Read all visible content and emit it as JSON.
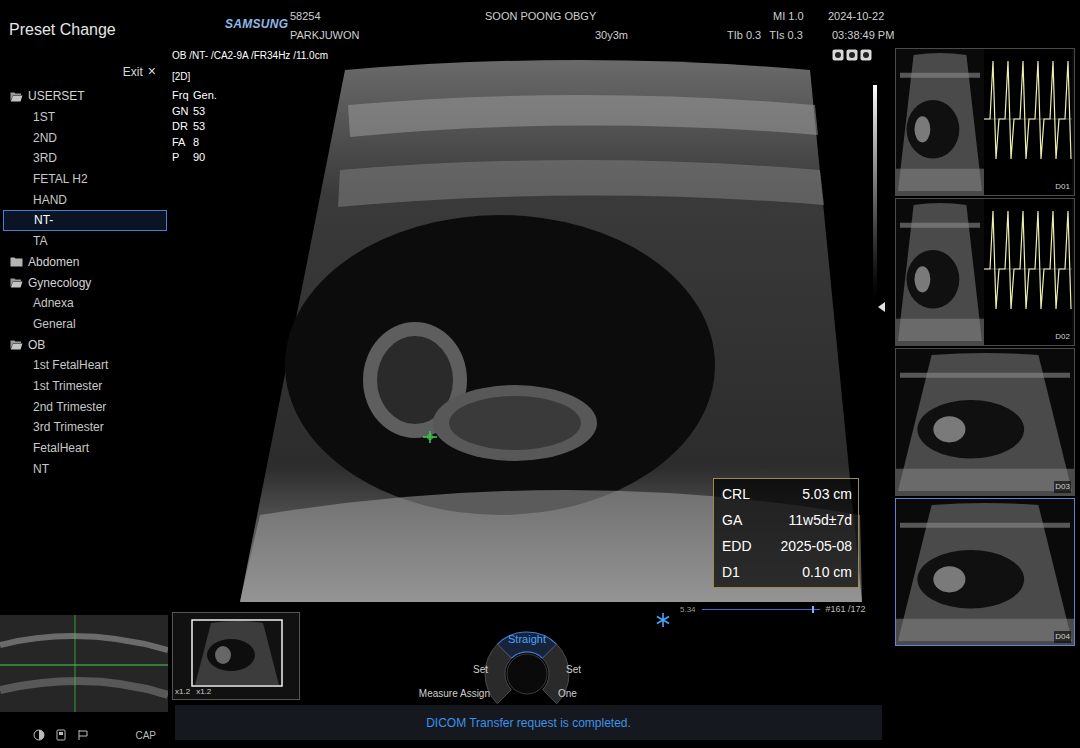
{
  "header": {
    "logo": "SAMSUNG",
    "patient_id": "58254",
    "patient_name": "PARKJUWON",
    "hospital": "SOON POONG OBGY",
    "age": "30y3m",
    "mi": "MI 1.0",
    "tib": "TIb 0.3",
    "tis": "TIs 0.3",
    "date": "2024-10-22",
    "time": "03:38:49 PM"
  },
  "preset_panel": {
    "title": "Preset Change",
    "exit": {
      "label": "Exit",
      "icon": "×"
    },
    "groups": [
      {
        "label": "USERSET",
        "expanded": true,
        "items": [
          {
            "label": "1ST",
            "selected": false
          },
          {
            "label": "2ND",
            "selected": false
          },
          {
            "label": "3RD",
            "selected": false
          },
          {
            "label": "FETAL H2",
            "selected": false
          },
          {
            "label": "HAND",
            "selected": false
          },
          {
            "label": "NT-",
            "selected": true
          },
          {
            "label": "TA",
            "selected": false
          }
        ]
      },
      {
        "label": "Abdomen",
        "expanded": false,
        "items": []
      },
      {
        "label": "Gynecology",
        "expanded": true,
        "items": [
          {
            "label": "Adnexa",
            "selected": false
          },
          {
            "label": "General",
            "selected": false
          }
        ]
      },
      {
        "label": "OB",
        "expanded": true,
        "items": [
          {
            "label": "1st FetalHeart",
            "selected": false
          },
          {
            "label": "1st Trimester",
            "selected": false
          },
          {
            "label": "2nd Trimester",
            "selected": false
          },
          {
            "label": "3rd Trimester",
            "selected": false
          },
          {
            "label": "FetalHeart",
            "selected": false
          },
          {
            "label": "NT",
            "selected": false
          }
        ]
      }
    ]
  },
  "image": {
    "info": "OB /NT- /CA2-9A /FR34Hz /11.0cm",
    "mode": "[2D]",
    "params": [
      {
        "label": "Frq",
        "value": "Gen."
      },
      {
        "label": "GN",
        "value": "53"
      },
      {
        "label": "DR",
        "value": "53"
      },
      {
        "label": "FA",
        "value": "8"
      },
      {
        "label": "P",
        "value": "90"
      }
    ],
    "measurements": [
      {
        "label": "CRL",
        "value": "5.03 cm"
      },
      {
        "label": "GA",
        "value": "11w5d±7d"
      },
      {
        "label": "EDD",
        "value": "2025-05-08"
      },
      {
        "label": "D1",
        "value": "0.10 cm"
      }
    ],
    "cine": {
      "depth": "5.34",
      "frame": "#161 /172",
      "level": 0.94
    }
  },
  "zoom_labels": [
    "x1.2",
    "x1.2"
  ],
  "dial": {
    "top": "Straight",
    "left": "Set",
    "right": "Set",
    "bottom_left": "Measure Assign",
    "bottom_right": "One"
  },
  "status_bar": "DICOM Transfer request is completed.",
  "cap": "CAP",
  "thumbnails": [
    {
      "label": "D01",
      "kind": "doppler",
      "selected": false
    },
    {
      "label": "D02",
      "kind": "doppler",
      "selected": false
    },
    {
      "label": "D03",
      "kind": "2d",
      "selected": false
    },
    {
      "label": "D04",
      "kind": "2d",
      "selected": true
    }
  ]
}
